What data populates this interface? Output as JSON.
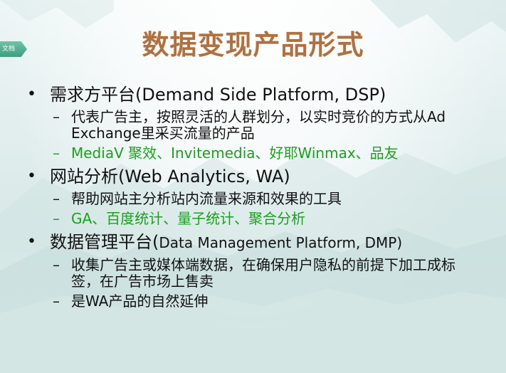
{
  "tab_label": "文档",
  "title": "数据变现产品形式",
  "bullets": [
    {
      "head": "需求方平台",
      "head_rest": "(Demand Side Platform, DSP)",
      "subs": [
        {
          "text": "代表广告主，按照灵活的人群划分，以实时竞价的方式从Ad Exchange里采买流量的产品",
          "color": "#111111"
        },
        {
          "text": "MediaV 聚效、Invitemedia、好耶Winmax、品友",
          "color": "#19a11e"
        }
      ]
    },
    {
      "head": "网站分析",
      "head_rest": "(Web Analytics, WA)",
      "subs": [
        {
          "text": "帮助网站主分析站内流量来源和效果的工具",
          "color": "#111111"
        },
        {
          "text": "GA、百度统计、量子统计、聚合分析",
          "color": "#19a11e"
        }
      ]
    },
    {
      "head": "数据管理平台(",
      "head_rest": "Data Management Platform, DMP)",
      "subs": [
        {
          "text": "收集广告主或媒体端数据，在确保用户隐私的前提下加工成标签，在广告市场上售卖",
          "color": "#111111"
        },
        {
          "text": "是WA产品的自然延伸",
          "color": "#111111"
        }
      ]
    }
  ]
}
